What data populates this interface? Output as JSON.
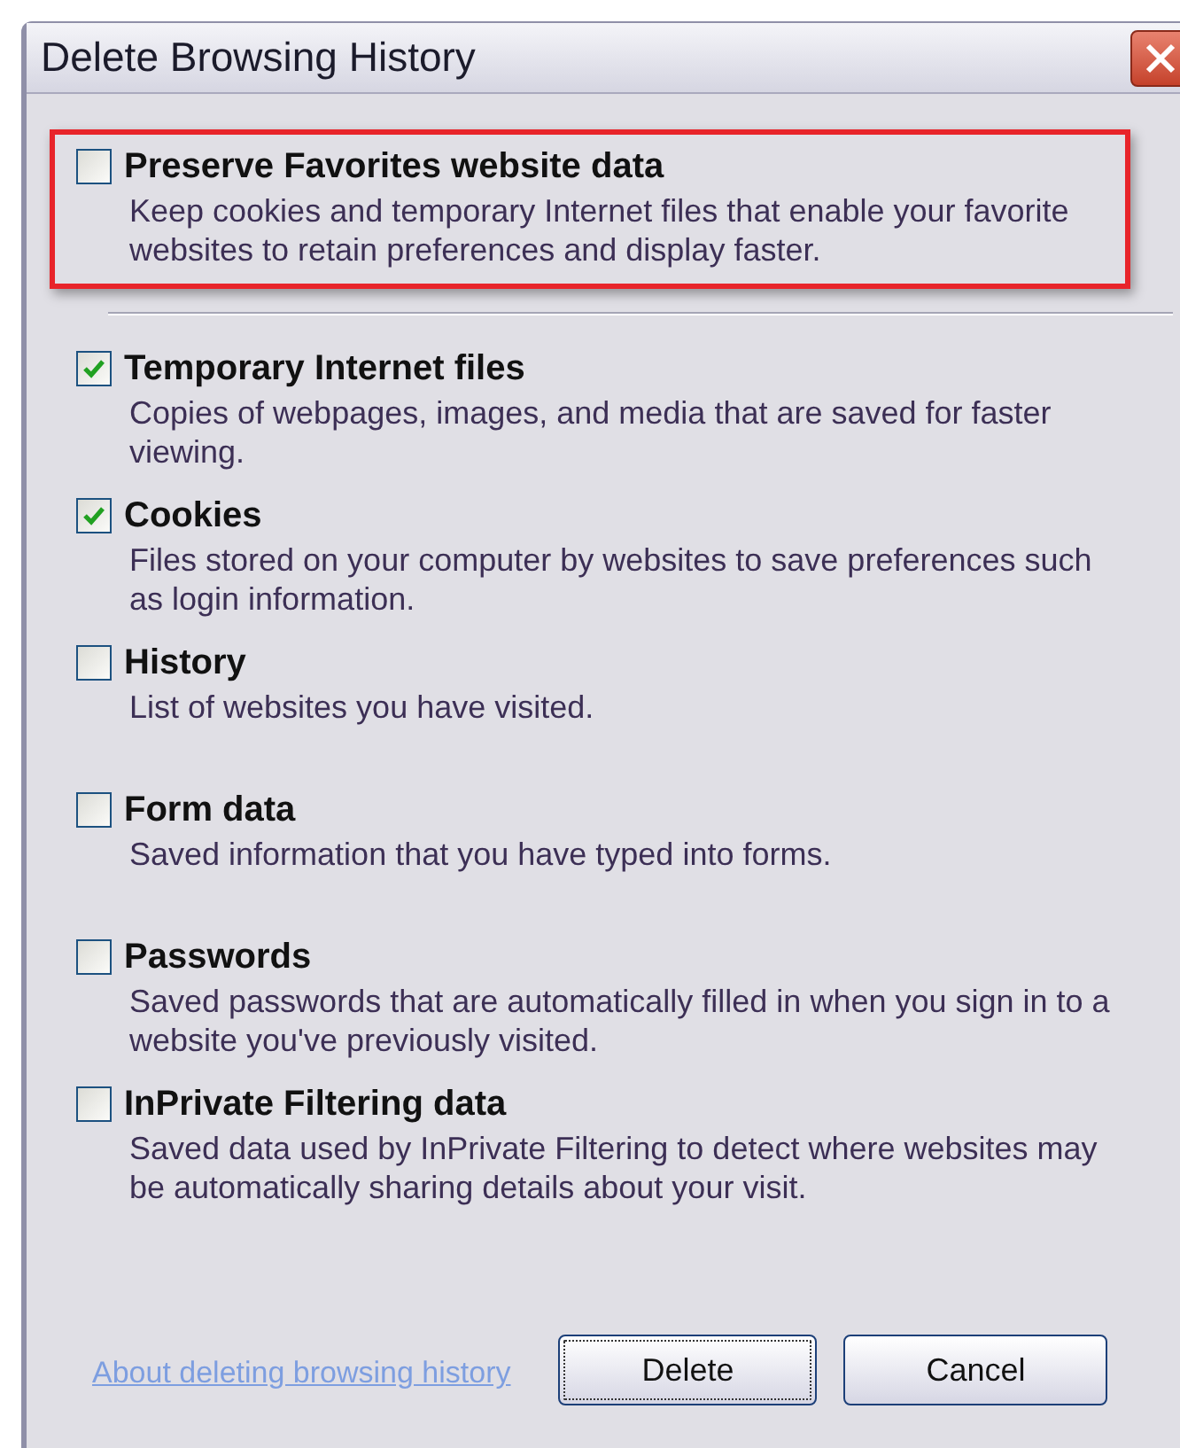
{
  "window": {
    "title": "Delete Browsing History"
  },
  "preserve": {
    "label": "Preserve Favorites website data",
    "description": "Keep cookies and temporary Internet files that enable your favorite websites to retain preferences and display faster.",
    "checked": false,
    "highlighted": true
  },
  "options": [
    {
      "label": "Temporary Internet files",
      "description": "Copies of webpages, images, and media that are saved for faster viewing.",
      "checked": true
    },
    {
      "label": "Cookies",
      "description": "Files stored on your computer by websites to save preferences such as login information.",
      "checked": true
    },
    {
      "label": "History",
      "description": "List of websites you have visited.",
      "checked": false
    },
    {
      "label": "Form data",
      "description": "Saved information that you have typed into forms.",
      "checked": false
    },
    {
      "label": "Passwords",
      "description": "Saved passwords that are automatically filled in when you sign in to a website you've previously visited.",
      "checked": false
    },
    {
      "label": "InPrivate Filtering data",
      "description": "Saved data used by InPrivate Filtering to detect where websites may be automatically sharing details about your visit.",
      "checked": false
    }
  ],
  "footer": {
    "link": "About deleting browsing history",
    "buttons": [
      {
        "label": "Delete",
        "focused": true
      },
      {
        "label": "Cancel",
        "focused": false
      }
    ]
  }
}
